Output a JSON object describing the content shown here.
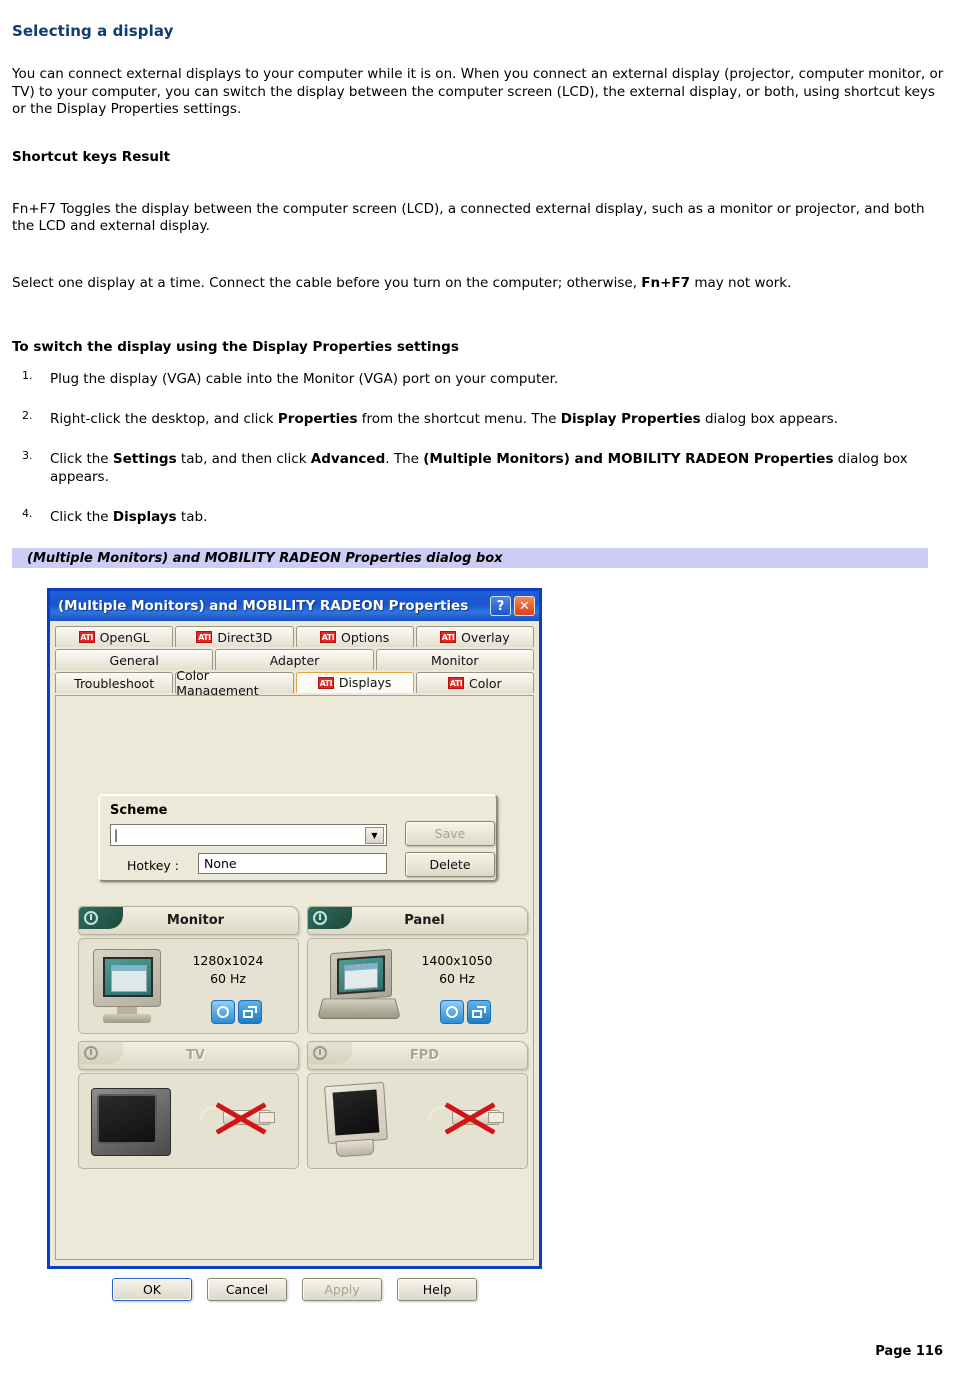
{
  "document": {
    "title": "Selecting a display",
    "intro": "You can connect external displays to your computer while it is on. When you connect an external display (projector, computer monitor, or TV) to your computer, you can switch the display between the computer screen (LCD), the external display, or both, using shortcut keys or the Display Properties settings.",
    "shortcut_heading": "Shortcut keys Result",
    "shortcut_row": "Fn+F7  Toggles the display between the computer screen (LCD), a connected external display, such as a monitor or projector, and both the LCD and external display.",
    "note_prefix": "Select one display at a time. Connect the cable before you turn on the computer; otherwise, ",
    "note_bold": "Fn+F7",
    "note_suffix": " may not work.",
    "steps_heading": "To switch the display using the Display Properties settings",
    "steps": [
      {
        "parts": [
          {
            "t": "Plug the display (VGA) cable into the Monitor (VGA) port on your computer.",
            "b": false
          }
        ]
      },
      {
        "parts": [
          {
            "t": "Right-click the desktop, and click ",
            "b": false
          },
          {
            "t": "Properties",
            "b": true
          },
          {
            "t": " from the shortcut menu. The ",
            "b": false
          },
          {
            "t": "Display Properties",
            "b": true
          },
          {
            "t": " dialog box appears.",
            "b": false
          }
        ]
      },
      {
        "parts": [
          {
            "t": "Click the ",
            "b": false
          },
          {
            "t": "Settings",
            "b": true
          },
          {
            "t": " tab, and then click ",
            "b": false
          },
          {
            "t": "Advanced",
            "b": true
          },
          {
            "t": ". The ",
            "b": false
          },
          {
            "t": "(Multiple Monitors) and MOBILITY RADEON Properties",
            "b": true
          },
          {
            "t": " dialog box appears.",
            "b": false
          }
        ]
      },
      {
        "parts": [
          {
            "t": "Click the ",
            "b": false
          },
          {
            "t": "Displays",
            "b": true
          },
          {
            "t": " tab.",
            "b": false
          }
        ]
      }
    ],
    "figure_caption": "(Multiple Monitors) and MOBILITY RADEON Properties dialog box",
    "page_number": "Page 116"
  },
  "dialog": {
    "title": "(Multiple Monitors) and MOBILITY RADEON Properties",
    "titlebar_buttons": {
      "help": "?",
      "close": "✕"
    },
    "tab_rows": [
      [
        {
          "label": "OpenGL",
          "ati": true,
          "active": false
        },
        {
          "label": "Direct3D",
          "ati": true,
          "active": false
        },
        {
          "label": "Options",
          "ati": true,
          "active": false
        },
        {
          "label": "Overlay",
          "ati": true,
          "active": false
        }
      ],
      [
        {
          "label": "General",
          "ati": false,
          "active": false
        },
        {
          "label": "Adapter",
          "ati": false,
          "active": false
        },
        {
          "label": "Monitor",
          "ati": false,
          "active": false
        }
      ],
      [
        {
          "label": "Troubleshoot",
          "ati": false,
          "active": false
        },
        {
          "label": "Color Management",
          "ati": false,
          "active": false
        },
        {
          "label": "Displays",
          "ati": true,
          "active": true
        },
        {
          "label": "Color",
          "ati": true,
          "active": false
        }
      ]
    ],
    "ati_logo_text": "ATI",
    "scheme": {
      "group_label": "Scheme",
      "combo_value": "",
      "combo_placeholder": "",
      "dropdown_glyph": "▼",
      "hotkey_label": "Hotkey :",
      "hotkey_value": "None",
      "save_label": "Save",
      "delete_label": "Delete"
    },
    "displays": [
      {
        "name": "Monitor",
        "enabled": true,
        "resolution": "1280x1024",
        "refresh": "60 Hz",
        "device_art": "crt-monitor"
      },
      {
        "name": "Panel",
        "enabled": true,
        "resolution": "1400x1050",
        "refresh": "60 Hz",
        "device_art": "laptop-panel"
      },
      {
        "name": "TV",
        "enabled": false,
        "resolution": "",
        "refresh": "",
        "device_art": "tv"
      },
      {
        "name": "FPD",
        "enabled": false,
        "resolution": "",
        "refresh": "",
        "device_art": "flat-panel"
      }
    ],
    "buttons": [
      {
        "label": "OK",
        "state": "default"
      },
      {
        "label": "Cancel",
        "state": "normal"
      },
      {
        "label": "Apply",
        "state": "disabled"
      },
      {
        "label": "Help",
        "state": "normal"
      }
    ]
  },
  "colors": {
    "heading": "#123a74",
    "caption_banner": "#ccccf5",
    "dialog_border": "#0a3fc4",
    "dialog_face": "#ece9d8",
    "active_tab_accent": "#e8a33d",
    "ati_red": "#e8251f",
    "enabled_power": "#2e6b5c"
  }
}
